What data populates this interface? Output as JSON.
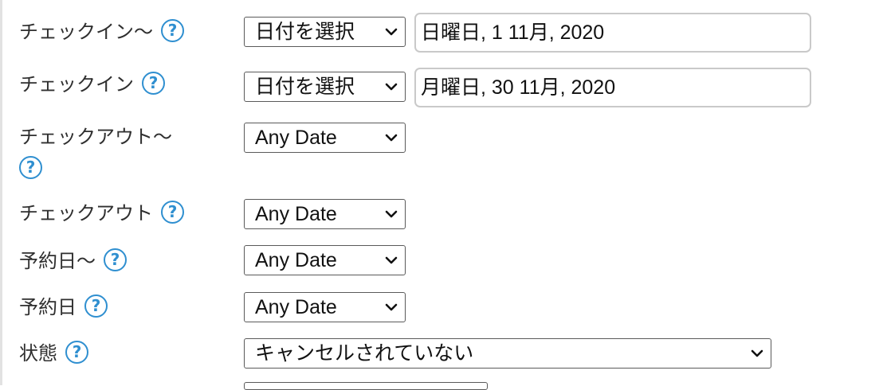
{
  "help_glyph": "?",
  "rows": [
    {
      "label": "チェックイン〜",
      "select": "日付を選択",
      "input": "日曜日, 1 11月, 2020"
    },
    {
      "label": "チェックイン",
      "select": "日付を選択",
      "input": "月曜日, 30 11月, 2020"
    },
    {
      "label": "チェックアウト〜",
      "select": "Any Date"
    },
    {
      "label": "チェックアウト",
      "select": "Any Date"
    },
    {
      "label": "予約日〜",
      "select": "Any Date"
    },
    {
      "label": "予約日",
      "select": "Any Date"
    },
    {
      "label": "状態",
      "select": "キャンセルされていない"
    }
  ],
  "colors": {
    "help_accent": "#2f8fd0",
    "border": "#5a5a5a",
    "input_border": "#c9c9c9"
  },
  "icons": {
    "help": "help-circle-icon",
    "dropdown": "chevron-down-icon"
  }
}
